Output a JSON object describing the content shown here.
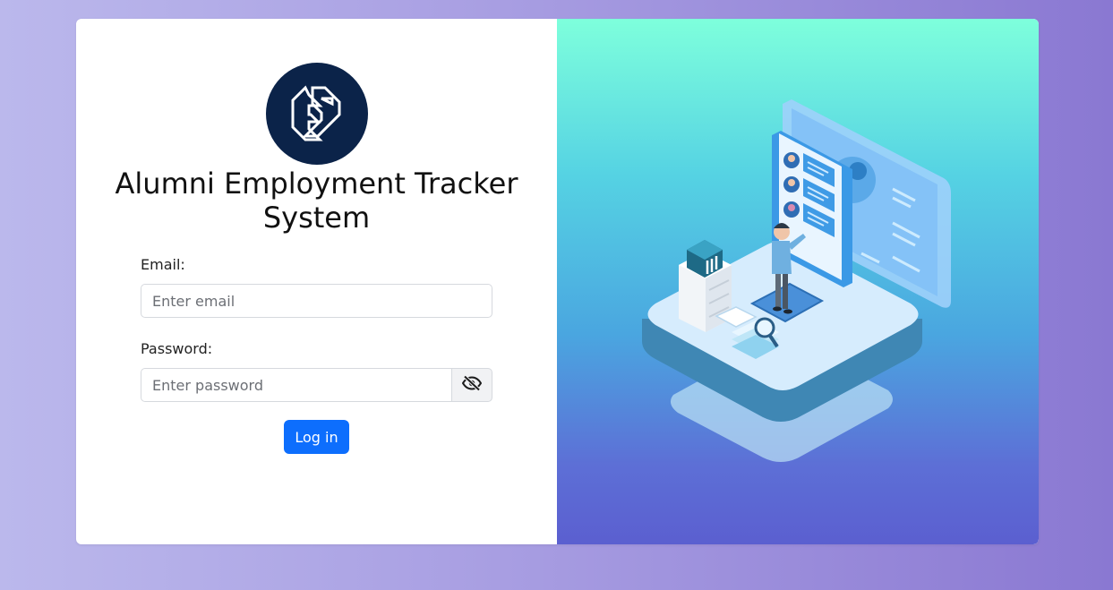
{
  "app": {
    "title": "Alumni Employment Tracker System"
  },
  "form": {
    "email_label": "Email:",
    "email_placeholder": "Enter email",
    "email_value": "",
    "password_label": "Password:",
    "password_placeholder": "Enter password",
    "password_value": "",
    "login_label": "Log in"
  },
  "icons": {
    "logo": "ae-logo-icon",
    "toggle_password": "eye-slash-icon",
    "illustration": "isometric-recruitment-illustration"
  },
  "colors": {
    "accent": "#0d6efd",
    "logo_bg": "#0b2349",
    "panel_gradient_top": "#7effdc",
    "panel_gradient_bottom": "#5b5fd0"
  }
}
